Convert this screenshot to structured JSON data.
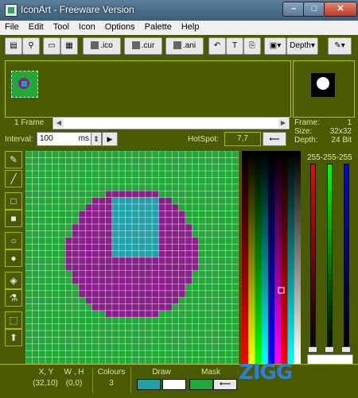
{
  "window": {
    "title": "IconArt - Freeware Version"
  },
  "menu": [
    "File",
    "Edit",
    "Tool",
    "Icon",
    "Options",
    "Palette",
    "Help"
  ],
  "toolbar": {
    "ico": ".ico",
    "cur": ".cur",
    "ani": ".ani",
    "depth": "Depth"
  },
  "frames": {
    "label": "1 Frame"
  },
  "info": {
    "frame_label": "Frame:",
    "frame_value": "1",
    "size_label": "Size:",
    "size_value": "32x32",
    "depth_label": "Depth:",
    "depth_value": "24 Bit"
  },
  "interval": {
    "label": "Interval:",
    "value": "100",
    "unit": "ms"
  },
  "hotspot": {
    "label": "HotSpot:",
    "value": "7,7"
  },
  "rgb": {
    "title": "255-255-255"
  },
  "status": {
    "xy_label": "X, Y",
    "xy_value": "(32,10)",
    "wh_label": "W , H",
    "wh_value": "(0,0)",
    "colours_label": "Colours",
    "colours_value": "3",
    "draw_label": "Draw",
    "mask_label": "Mask"
  },
  "watermark": "ZIGG",
  "colors": {
    "green": "#22a838",
    "purple": "#8a1e8a",
    "cyan": "#22a0a8",
    "panel": "#4a5a00"
  }
}
